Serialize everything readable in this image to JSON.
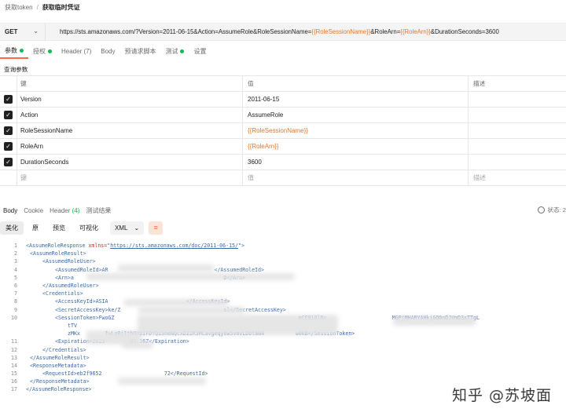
{
  "breadcrumb": {
    "parent": "获取token",
    "separator": "/",
    "current": "获取临时凭证"
  },
  "request": {
    "method": "GET",
    "url_parts": [
      {
        "text": "https://sts.amazonaws.com/?Version=2011-06-15&Action=AssumeRole&RoleSessionName=",
        "var": false
      },
      {
        "text": "{{RoleSessionName}}",
        "var": true
      },
      {
        "text": "&RoleArn=",
        "var": false
      },
      {
        "text": "{{RoleArn}}",
        "var": true
      },
      {
        "text": "&DurationSeconds=3600",
        "var": false
      }
    ]
  },
  "request_tabs": [
    {
      "label": "参数",
      "dot": true,
      "active": true
    },
    {
      "label": "授权",
      "dot": true,
      "active": false
    },
    {
      "label": "Header (7)",
      "dot": false,
      "active": false
    },
    {
      "label": "Body",
      "dot": false,
      "active": false
    },
    {
      "label": "预请求脚本",
      "dot": false,
      "active": false
    },
    {
      "label": "测试",
      "dot": true,
      "active": false
    },
    {
      "label": "设置",
      "dot": false,
      "active": false
    }
  ],
  "params": {
    "section_title": "查询参数",
    "headers": {
      "key": "键",
      "value": "值",
      "description": "描述"
    },
    "rows": [
      {
        "key": "Version",
        "value": "2011-06-15",
        "is_var": false
      },
      {
        "key": "Action",
        "value": "AssumeRole",
        "is_var": false
      },
      {
        "key": "RoleSessionName",
        "value": "{{RoleSessionName}}",
        "is_var": true
      },
      {
        "key": "RoleArn",
        "value": "{{RoleArn}}",
        "is_var": true
      },
      {
        "key": "DurationSeconds",
        "value": "3600",
        "is_var": false
      }
    ],
    "placeholder": {
      "key": "键",
      "value": "值",
      "description": "描述"
    }
  },
  "response_tabs": [
    {
      "label": "Body",
      "count": "",
      "active": true
    },
    {
      "label": "Cookie",
      "count": "",
      "active": false
    },
    {
      "label": "Header",
      "count": "(4)",
      "active": false
    },
    {
      "label": "测试结果",
      "count": "",
      "active": false
    }
  ],
  "status_text": "状态: 2",
  "view_modes": [
    {
      "label": "美化",
      "active": true
    },
    {
      "label": "原",
      "active": false
    },
    {
      "label": "预览",
      "active": false
    },
    {
      "label": "可视化",
      "active": false
    }
  ],
  "format": {
    "label": "XML",
    "caret": "⌄"
  },
  "code_lines": [
    {
      "n": "1",
      "indent": 0,
      "parts": [
        {
          "t": "<AssumeRoleResponse ",
          "c": "tag"
        },
        {
          "t": "xmlns=",
          "c": "attr"
        },
        {
          "t": "\"",
          "c": "tag"
        },
        {
          "t": "https://sts.amazonaws.com/doc/2011-06-15/",
          "c": "str"
        },
        {
          "t": "\">",
          "c": "tag"
        }
      ]
    },
    {
      "n": "2",
      "indent": 1,
      "parts": [
        {
          "t": "<AssumeRoleResult>",
          "c": "tag"
        }
      ]
    },
    {
      "n": "3",
      "indent": 2,
      "parts": [
        {
          "t": "<AssumedRoleUser>",
          "c": "tag"
        }
      ]
    },
    {
      "n": "4",
      "indent": 3,
      "parts": [
        {
          "t": "<AssumedRoleId>AR",
          "c": "tag"
        },
        {
          "t": "                                  ",
          "c": "txt"
        },
        {
          "t": "</AssumedRoleId>",
          "c": "tag"
        }
      ]
    },
    {
      "n": "5",
      "indent": 3,
      "parts": [
        {
          "t": "<Arn>a",
          "c": "tag"
        },
        {
          "t": "                                                ",
          "c": "txt"
        },
        {
          "t": "D</Arn>",
          "c": "tag"
        }
      ]
    },
    {
      "n": "6",
      "indent": 2,
      "parts": [
        {
          "t": "</AssumedRoleUser>",
          "c": "tag"
        }
      ]
    },
    {
      "n": "7",
      "indent": 2,
      "parts": [
        {
          "t": "<Credentials>",
          "c": "tag"
        }
      ]
    },
    {
      "n": "8",
      "indent": 3,
      "parts": [
        {
          "t": "<AccessKeyId>ASIA",
          "c": "tag"
        },
        {
          "t": "                         ",
          "c": "txt"
        },
        {
          "t": "</AccessKeyId>",
          "c": "tag"
        }
      ]
    },
    {
      "n": "9",
      "indent": 3,
      "parts": [
        {
          "t": "<SecretAccessKey>ke/Z",
          "c": "tag"
        },
        {
          "t": "                                 ",
          "c": "txt"
        },
        {
          "t": "sl</SecretAccessKey>",
          "c": "tag"
        }
      ]
    },
    {
      "n": "10",
      "indent": 3,
      "parts": [
        {
          "t": "<SessionToken>FwoGZ",
          "c": "tag"
        },
        {
          "t": "                                                           ",
          "c": "txt"
        },
        {
          "t": "mCE010lNo",
          "c": "tag"
        },
        {
          "t": "                     ",
          "c": "txt"
        },
        {
          "t": "MGPjMHARYAHkjGQ0nDJVmD3sTTgL",
          "c": "tag"
        }
      ]
    },
    {
      "n": "",
      "indent": 4,
      "parts": [
        {
          "t": "tTV",
          "c": "tag"
        },
        {
          "t": "                                                                      ",
          "c": "txt"
        }
      ]
    },
    {
      "n": "",
      "indent": 4,
      "parts": [
        {
          "t": "zMKx",
          "c": "tag"
        },
        {
          "t": "        ",
          "c": "txt"
        },
        {
          "t": "IwLgBjIthOUpIFDfQiSheNQcxD22R3MCavgeqy6w5vmvLDbt8N4",
          "c": "tag"
        },
        {
          "t": "          ",
          "c": "txt"
        },
        {
          "t": "w0KB</SessionToken>",
          "c": "tag"
        }
      ]
    },
    {
      "n": "11",
      "indent": 3,
      "parts": [
        {
          "t": "<Expiration>2023-",
          "c": "tag"
        },
        {
          "t": "       ",
          "c": "txt"
        },
        {
          "t": "02:16Z</Expiration>",
          "c": "tag"
        }
      ]
    },
    {
      "n": "12",
      "indent": 2,
      "parts": [
        {
          "t": "</Credentials>",
          "c": "tag"
        }
      ]
    },
    {
      "n": "13",
      "indent": 1,
      "parts": [
        {
          "t": "</AssumeRoleResult>",
          "c": "tag"
        }
      ]
    },
    {
      "n": "14",
      "indent": 1,
      "parts": [
        {
          "t": "<ResponseMetadata>",
          "c": "tag"
        }
      ]
    },
    {
      "n": "15",
      "indent": 2,
      "parts": [
        {
          "t": "<RequestId>eb2f9652",
          "c": "tag"
        },
        {
          "t": "                    ",
          "c": "txt"
        },
        {
          "t": "72</RequestId>",
          "c": "tag"
        }
      ]
    },
    {
      "n": "16",
      "indent": 1,
      "parts": [
        {
          "t": "</ResponseMetadata>",
          "c": "tag"
        }
      ]
    },
    {
      "n": "17",
      "indent": 0,
      "parts": [
        {
          "t": "</AssumeRoleResponse>",
          "c": "tag"
        }
      ]
    }
  ],
  "watermark": "知乎 @苏坡面",
  "colors": {
    "accent": "#ff6c37",
    "variable": "#e0782d",
    "success": "#0cbb52",
    "xml_tag": "#3d6ba8",
    "xml_attr": "#c9302c"
  }
}
